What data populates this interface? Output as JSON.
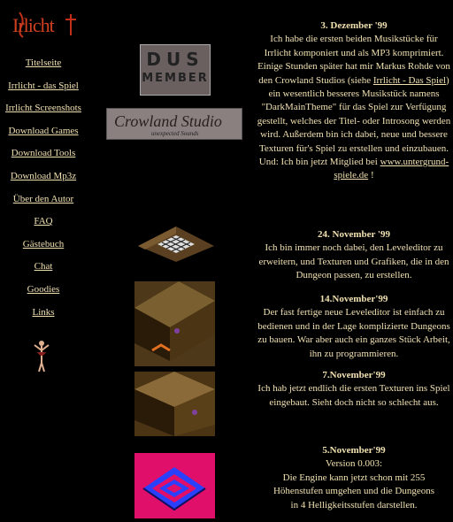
{
  "logo": {
    "text": "Irlicht"
  },
  "nav": [
    "Titelseite",
    "Irrlicht - das Spiel",
    "Irrlicht Screenshots",
    "Download Games",
    "Download Tools",
    "Download Mp3z",
    "Über den Autor",
    "FAQ",
    "Gästebuch",
    "Chat",
    "Goodies",
    "Links"
  ],
  "badges": {
    "dus_line1": "DUS",
    "dus_line2": "MEMBER",
    "crowland_title": "Crowland Studio",
    "crowland_sub": "unexpected Sounds"
  },
  "news": [
    {
      "date": "3. Dezember '99",
      "pre": "Ich habe die ersten beiden Musikstücke für Irrlicht komponiert und als MP3 komprimiert. Einige Stunden später hat mir Markus Rohde von den Crowland Studios (siehe ",
      "link1": "Irrlicht - Das Spiel",
      "mid": ") ein wesentlich besseres Musikstück namens \"DarkMainTheme\" für das Spiel zur Verfügung gestellt, welches der Titel- oder Introsong werden wird. Außerdem bin ich dabei, neue und bessere Texturen für's Spiel zu erstellen und einzubauen.",
      "post_pre": "Und: Ich bin jetzt Mitglied bei ",
      "link2": "www.untergrund-spiele.de",
      "post": " !"
    },
    {
      "date": "24. November '99",
      "text": "Ich bin immer noch dabei, den Leveleditor zu erweitern, und Texturen und Grafiken, die in den Dungeon passen, zu erstellen."
    },
    {
      "date": "14.November'99",
      "text": "Der fast fertige neue Leveleditor ist einfach zu bedienen und in der Lage komplizierte Dungeons zu bauen. War aber auch ein ganzes Stück Arbeit, ihn zu programmieren."
    },
    {
      "date": "7.November'99",
      "text": "Ich hab jetzt endlich die ersten Texturen ins Spiel eingebaut. Sieht doch nicht so schlecht aus."
    },
    {
      "date": "5.November'99",
      "version": "Version 0.003:",
      "line1": "Die Engine kann jetzt schon mit 255",
      "line2": "Höhenstufen umgehen und die Dungeons",
      "line3": "in 4 Helligkeitsstufen darstellen."
    }
  ]
}
